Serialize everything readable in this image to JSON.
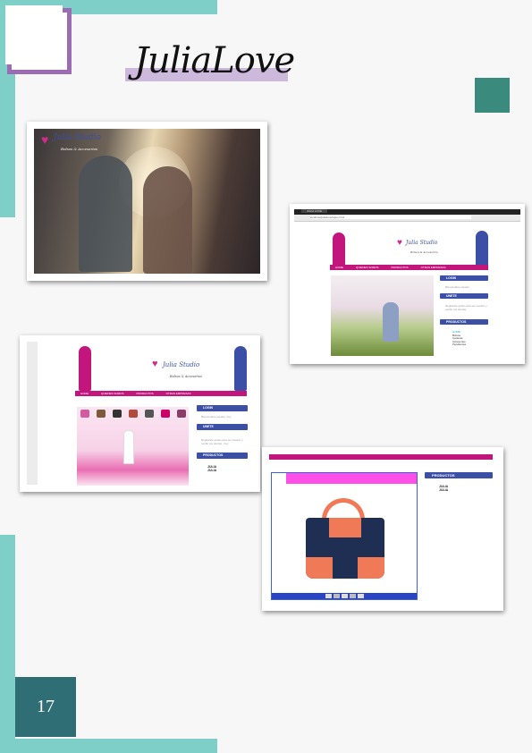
{
  "title": "JuliaLove",
  "page_number": "17",
  "colors": {
    "teal": "#7ecfc8",
    "purple": "#9b6bb3",
    "lavender": "#cdb9dc",
    "green": "#3a8b7e",
    "pagebox": "#2f6e74",
    "magenta": "#c2167d",
    "blue": "#3b4fa6"
  },
  "shot1": {
    "logo": "Julia Studio",
    "logo_sub": "Bolsos & Accesorios"
  },
  "shot2": {
    "tab": "JULIA LOVE",
    "address": "localhost/julialove/index.html",
    "logo": "Julia Studio",
    "logo_sub": "Bolsos & Accesorios",
    "nav": [
      "HOME",
      "QUIENES SOMOS",
      "PRODUCTOS",
      "OTRAS EMPRESAS"
    ],
    "login": "LOGIN",
    "login_text": "Bienvenidos usuario",
    "unete": "UNETE",
    "unete_text": "Registrate gratis para ser usuario y recibir tus ofertas",
    "productos": "PRODUCTOS",
    "product_links": [
      "HOME",
      "Bolsos",
      "Carteras",
      "Accesorios",
      "Pendientes"
    ]
  },
  "shot3": {
    "logo": "Julia Studio",
    "logo_sub": "Bolsos & Accesorios",
    "nav": [
      "HOME",
      "QUIENES SOMOS",
      "PRODUCTOS",
      "OTRAS EMPRESAS"
    ],
    "login": "LOGIN",
    "login_text": "Bienvenidos usuario, hoy",
    "unete": "UNETE",
    "unete_text": "Registrate gratis para ser usuario y recibir tus ofertas - hoy",
    "productos": "PRODUCTOS",
    "product_links": [
      "JULIA",
      "JULIA"
    ]
  },
  "shot4": {
    "productos": "PRODUCTOS",
    "product_links": [
      "JULIA",
      "JULIA"
    ]
  }
}
